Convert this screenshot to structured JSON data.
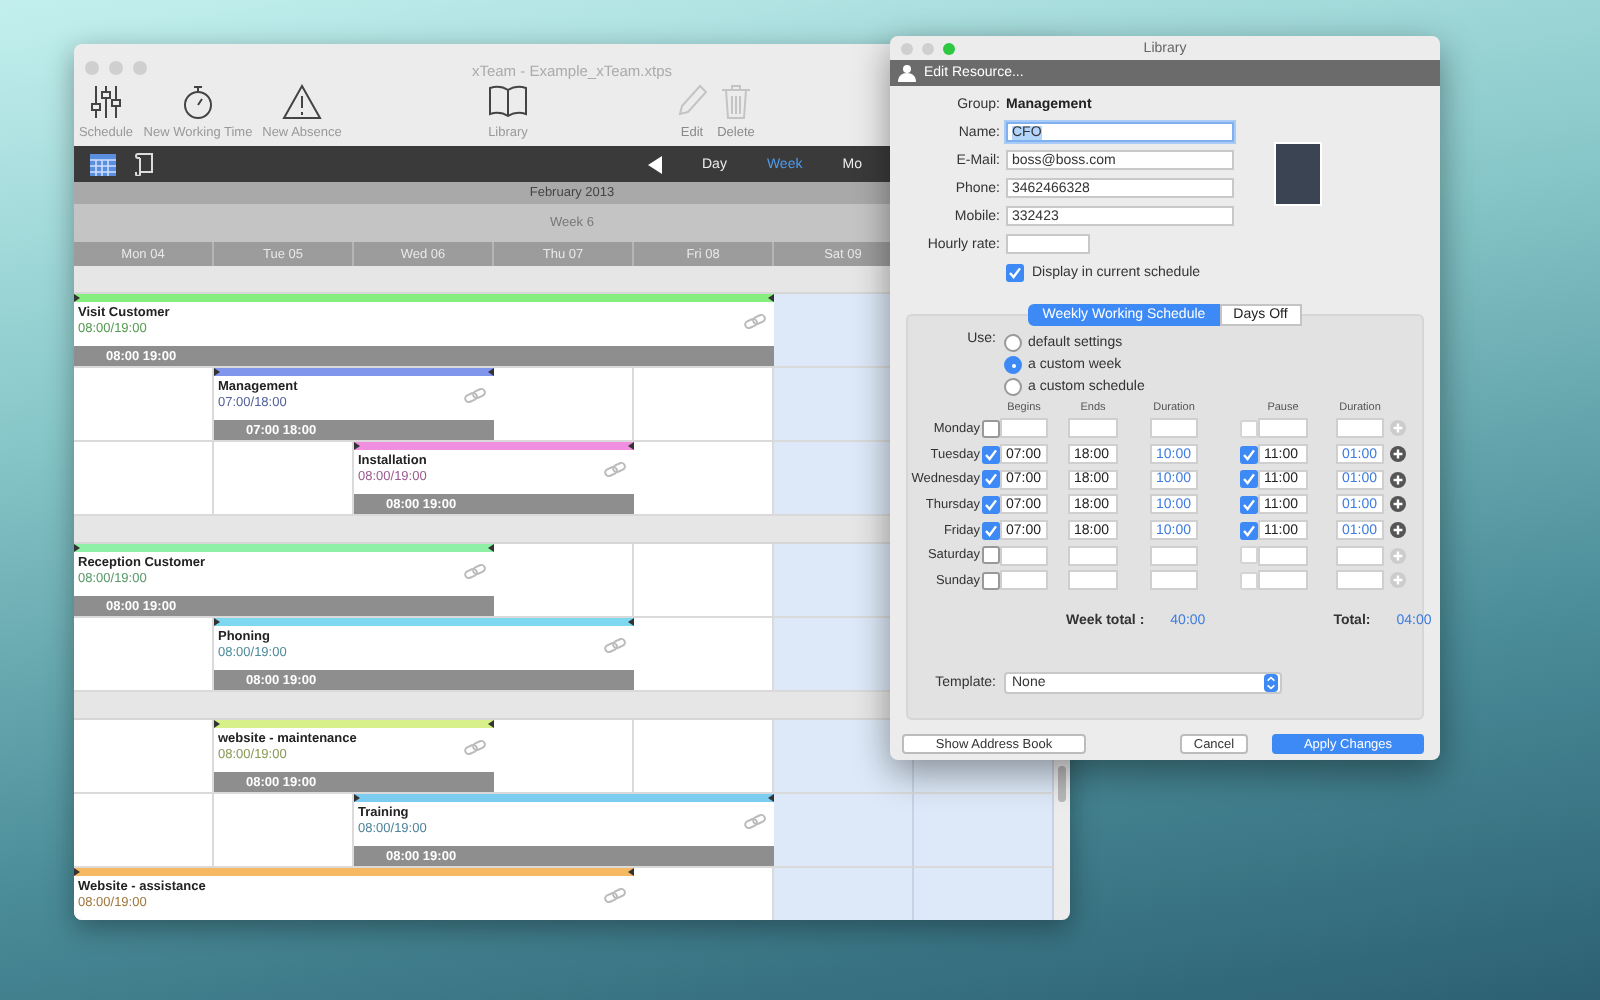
{
  "main_window": {
    "title": "xTeam - Example_xTeam.xtps",
    "toolbar": [
      {
        "label": "Schedule",
        "disabled": false
      },
      {
        "label": "New Working Time",
        "disabled": false
      },
      {
        "label": "New Absence",
        "disabled": false
      },
      {
        "label": "Library",
        "disabled": false
      },
      {
        "label": "Edit",
        "disabled": true
      },
      {
        "label": "Delete",
        "disabled": true
      }
    ],
    "view_tabs": [
      {
        "label": "Day",
        "selected": false
      },
      {
        "label": "Week",
        "selected": true
      },
      {
        "label": "Mo",
        "selected": false
      }
    ],
    "month": "February 2013",
    "week": "Week 6",
    "days": [
      "Mon 04",
      "Tue 05",
      "Wed 06",
      "Thu 07",
      "Fri 08",
      "Sat 09"
    ],
    "groups": [
      {
        "rows": [
          {
            "cells": [
              {
                "kind": "event",
                "title": "Visit Customer",
                "time": "08:00/19:00",
                "bar_label": "08:00 19:00",
                "color": "#86ee7e"
              },
              {
                "kind": "continued"
              },
              {
                "kind": "continued"
              },
              {
                "kind": "continued"
              },
              {
                "kind": "continued"
              },
              {
                "kind": "weekend"
              },
              {
                "kind": "weekend"
              }
            ]
          },
          {
            "cells": [
              {
                "kind": "empty"
              },
              {
                "kind": "event",
                "title": "Management",
                "time": "07:00/18:00",
                "bar_label": "07:00 18:00",
                "color": "#7f96ec"
              },
              {
                "kind": "continued"
              },
              {
                "kind": "empty"
              },
              {
                "kind": "empty"
              },
              {
                "kind": "weekend"
              },
              {
                "kind": "weekend"
              }
            ]
          },
          {
            "cells": [
              {
                "kind": "empty"
              },
              {
                "kind": "empty"
              },
              {
                "kind": "event",
                "title": "Installation",
                "time": "08:00/19:00",
                "bar_label": "08:00 19:00",
                "color": "#f08ee0"
              },
              {
                "kind": "continued"
              },
              {
                "kind": "empty"
              },
              {
                "kind": "weekend"
              },
              {
                "kind": "weekend"
              }
            ]
          }
        ]
      },
      {
        "rows": [
          {
            "cells": [
              {
                "kind": "event",
                "title": "Reception Customer",
                "time": "08:00/19:00",
                "bar_label": "08:00 19:00",
                "color": "#8ef0a6"
              },
              {
                "kind": "continued"
              },
              {
                "kind": "continued"
              },
              {
                "kind": "empty"
              },
              {
                "kind": "empty"
              },
              {
                "kind": "weekend"
              },
              {
                "kind": "weekend"
              }
            ]
          },
          {
            "cells": [
              {
                "kind": "empty"
              },
              {
                "kind": "event",
                "title": "Phoning",
                "time": "08:00/19:00",
                "bar_label": "08:00 19:00",
                "color": "#7ed8f0"
              },
              {
                "kind": "continued"
              },
              {
                "kind": "continued"
              },
              {
                "kind": "empty"
              },
              {
                "kind": "weekend"
              },
              {
                "kind": "weekend"
              }
            ]
          }
        ]
      },
      {
        "rows": [
          {
            "cells": [
              {
                "kind": "empty"
              },
              {
                "kind": "event",
                "title": "website - maintenance",
                "time": "08:00/19:00",
                "bar_label": "08:00 19:00",
                "color": "#d8f08a"
              },
              {
                "kind": "continued"
              },
              {
                "kind": "empty"
              },
              {
                "kind": "empty"
              },
              {
                "kind": "weekend"
              },
              {
                "kind": "weekend"
              }
            ]
          },
          {
            "cells": [
              {
                "kind": "empty"
              },
              {
                "kind": "empty"
              },
              {
                "kind": "event",
                "title": "Training",
                "time": "08:00/19:00",
                "bar_label": "08:00 19:00",
                "color": "#7cccf2"
              },
              {
                "kind": "continued"
              },
              {
                "kind": "continued"
              },
              {
                "kind": "weekend"
              },
              {
                "kind": "weekend"
              }
            ]
          },
          {
            "cells": [
              {
                "kind": "event",
                "title": "Website - assistance",
                "time": "08:00/19:00",
                "color": "#f6b860"
              },
              {
                "kind": "continued"
              },
              {
                "kind": "continued"
              },
              {
                "kind": "continued"
              },
              {
                "kind": "empty"
              },
              {
                "kind": "weekend"
              },
              {
                "kind": "weekend"
              }
            ]
          }
        ]
      }
    ]
  },
  "dialog": {
    "title": "Library",
    "header": "Edit Resource...",
    "group_label": "Group:",
    "group": "Management",
    "fields": [
      {
        "label": "Name:",
        "value": "CFO",
        "focused": true,
        "kind": "text"
      },
      {
        "label": "E-Mail:",
        "value": "boss@boss.com",
        "focused": false,
        "kind": "text"
      },
      {
        "label": "Phone:",
        "value": "3462466328",
        "focused": false,
        "kind": "text"
      },
      {
        "label": "Mobile:",
        "value": "332423",
        "focused": false,
        "kind": "text"
      },
      {
        "label": "Hourly rate:",
        "focused": false,
        "kind": "rate"
      }
    ],
    "display_checkbox": {
      "label": "Display in current schedule",
      "checked": true
    },
    "tabs": [
      {
        "label": "Weekly Working Schedule",
        "selected": true
      },
      {
        "label": "Days Off",
        "selected": false
      }
    ],
    "use_label": "Use:",
    "use_options": [
      {
        "label": "default settings",
        "selected": false
      },
      {
        "label": "a custom week",
        "selected": true
      },
      {
        "label": "a custom schedule",
        "selected": false
      }
    ],
    "columns": [
      "Begins",
      "Ends",
      "Duration",
      "Pause",
      "Duration"
    ],
    "days": [
      {
        "day": "Monday",
        "checked": false,
        "pause_checked": false
      },
      {
        "day": "Tuesday",
        "checked": true,
        "begins": "07:00",
        "ends": "18:00",
        "duration": "10:00",
        "pause_checked": true,
        "pause": "11:00",
        "pause_duration": "01:00"
      },
      {
        "day": "Wednesday",
        "checked": true,
        "begins": "07:00",
        "ends": "18:00",
        "duration": "10:00",
        "pause_checked": true,
        "pause": "11:00",
        "pause_duration": "01:00"
      },
      {
        "day": "Thursday",
        "checked": true,
        "begins": "07:00",
        "ends": "18:00",
        "duration": "10:00",
        "pause_checked": true,
        "pause": "11:00",
        "pause_duration": "01:00"
      },
      {
        "day": "Friday",
        "checked": true,
        "begins": "07:00",
        "ends": "18:00",
        "duration": "10:00",
        "pause_checked": true,
        "pause": "11:00",
        "pause_duration": "01:00"
      },
      {
        "day": "Saturday",
        "checked": false,
        "pause_checked": false
      },
      {
        "day": "Sunday",
        "checked": false,
        "pause_checked": false
      }
    ],
    "week_total_label": "Week total :",
    "week_total": "40:00",
    "total_label": "Total:",
    "total": "04:00",
    "template_label": "Template:",
    "template": "None",
    "buttons": [
      {
        "label": "Show Address Book",
        "kind": "plain"
      },
      {
        "label": "Cancel",
        "kind": "plain"
      },
      {
        "label": "Apply Changes",
        "kind": "default"
      }
    ]
  }
}
